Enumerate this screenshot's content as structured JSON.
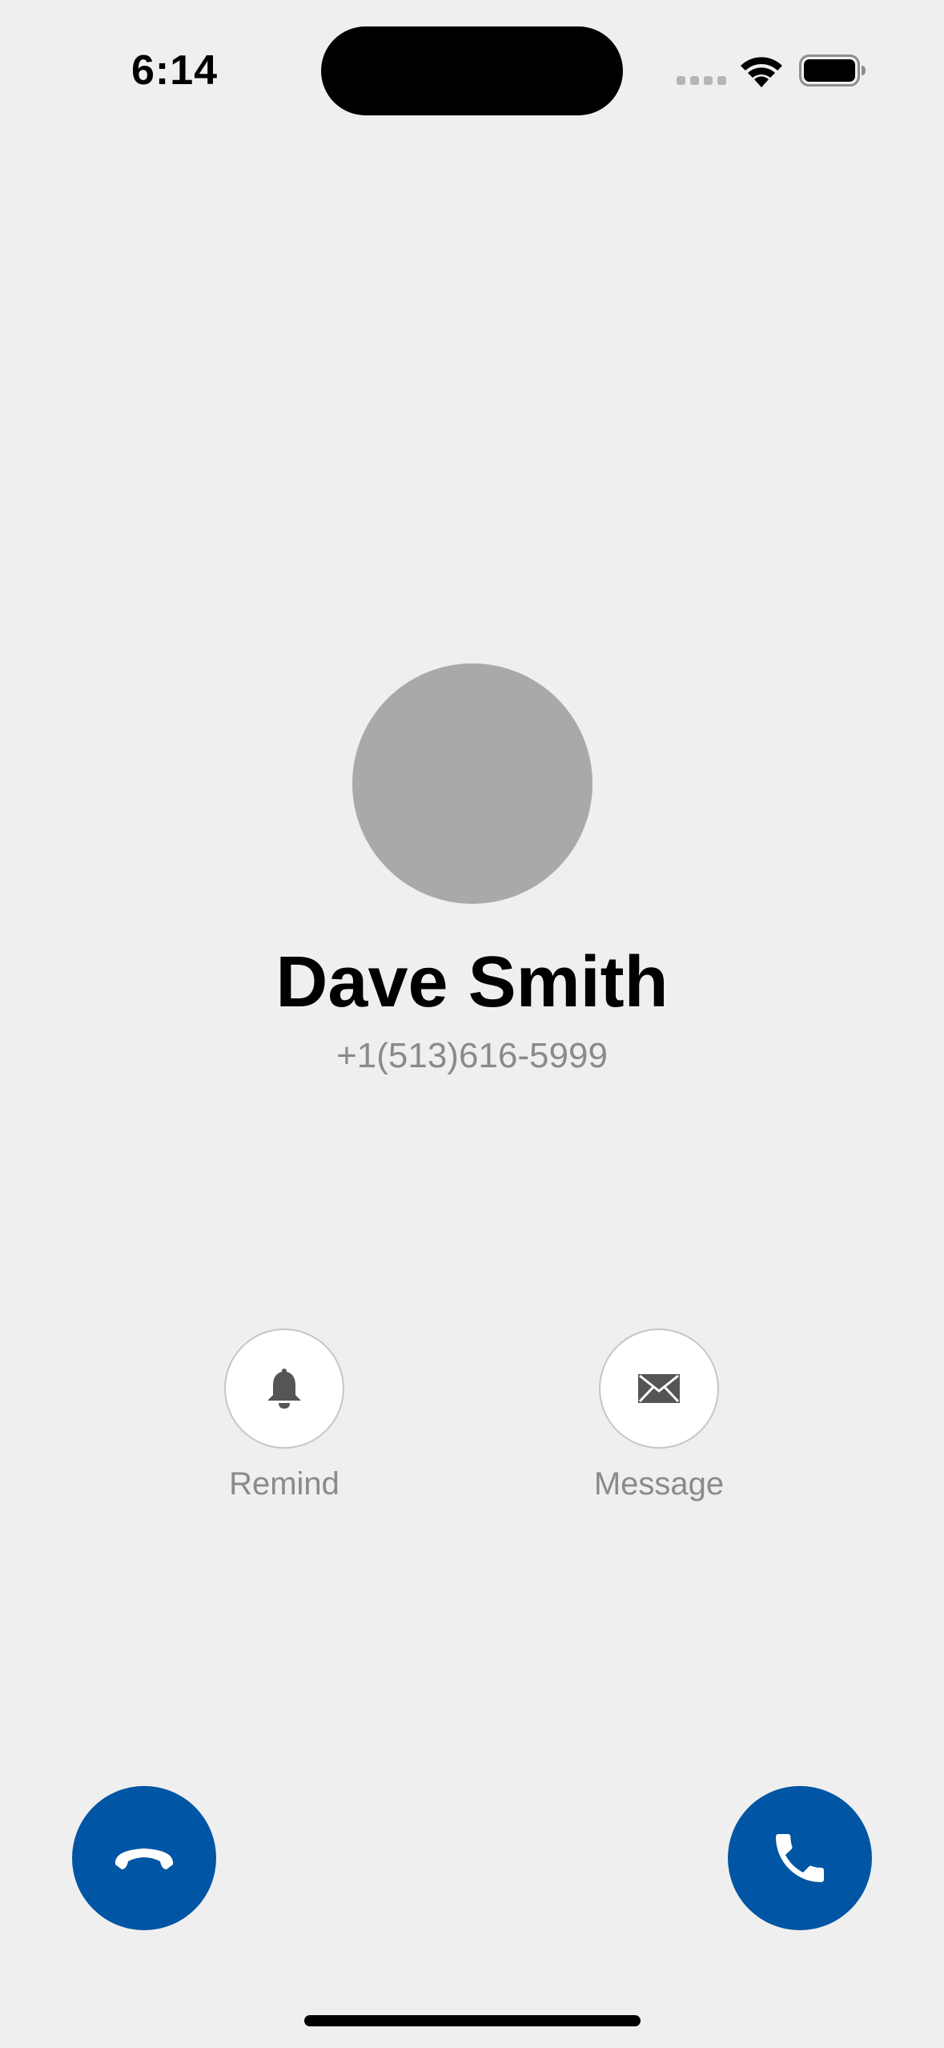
{
  "status_bar": {
    "time": "6:14"
  },
  "caller": {
    "name": "Dave Smith",
    "number": "+1(513)616-5999"
  },
  "actions": {
    "remind": {
      "label": "Remind",
      "icon": "bell-icon"
    },
    "message": {
      "label": "Message",
      "icon": "envelope-icon"
    }
  },
  "call_buttons": {
    "decline_icon": "phone-decline-icon",
    "accept_icon": "phone-accept-icon",
    "color": "#0055a4"
  }
}
